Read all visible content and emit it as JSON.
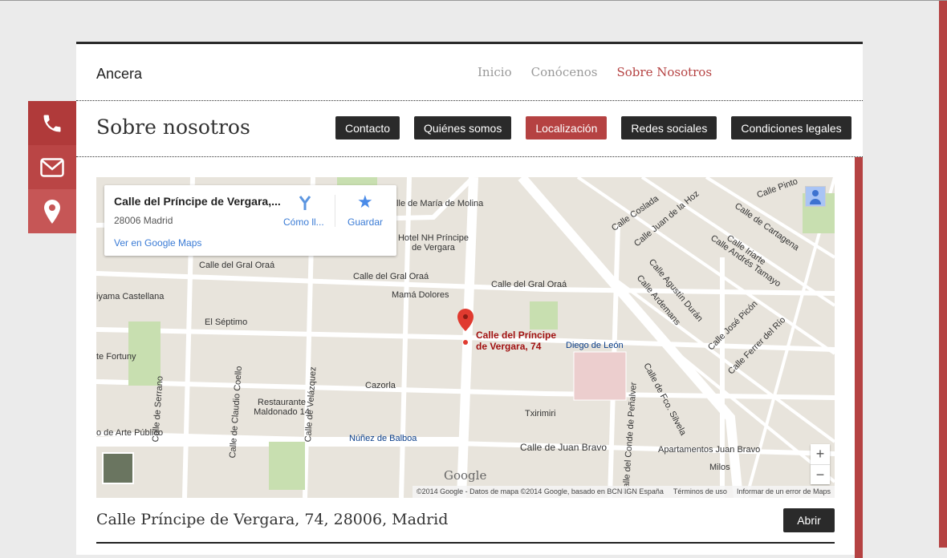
{
  "header": {
    "brand": "Ancera",
    "nav": [
      "Inicio",
      "Conócenos",
      "Sobre Nosotros"
    ]
  },
  "page": {
    "title": "Sobre nosotros",
    "tabs": [
      "Contacto",
      "Quiénes somos",
      "Localización",
      "Redes sociales",
      "Condiciones legales"
    ],
    "active_tab": "Localización"
  },
  "side_icons": [
    "phone-icon",
    "mail-icon",
    "location-icon"
  ],
  "map": {
    "card": {
      "title": "Calle del Príncipe de Vergara,...",
      "subtitle": "28006 Madrid",
      "link": "Ver en Google Maps",
      "directions": "Cómo ll...",
      "save": "Guardar"
    },
    "pin_label": "Calle del Príncipe de Vergara, 74",
    "labels": [
      "Calle de María de Molina",
      "Hotel NH Príncipe de Vergara",
      "Calle del Gral Oraá",
      "Calle del Gral Oraá",
      "Calle del Gral Oraá",
      "Mamá Dolores",
      "El Séptimo",
      "Diego de León",
      "Cazorla",
      "Restaurante Maldonado 14",
      "Núñez de Balboa",
      "Calle de Juan Bravo",
      "Txirimiri",
      "Apartamentos Juan Bravo",
      "Milos",
      "Calle de Serrano",
      "Calle de Claudio Coello",
      "Calle de Velázquez",
      "Calle del Conde de Peñalver",
      "Calle de Fco. Silvela",
      "Calle Coslada",
      "Calle Juan de la Hoz",
      "Calle de Cartagena",
      "Calle Iriarte",
      "Calle Andrés Tamayo",
      "Calle Agustín Durán",
      "Calle Ardemans",
      "Calle José Picón",
      "Calle Ferrer del Río",
      "iyama Castellana",
      "te Fortuny",
      "o de Arte Público",
      "Calle Pinto"
    ],
    "zoom_in": "+",
    "zoom_out": "−",
    "attribution": [
      "©2014 Google - Datos de mapa ©2014 Google, basado en BCN IGN España",
      "Términos de uso",
      "Informar de un error de Maps"
    ],
    "logo": "Google"
  },
  "address": "Calle Príncipe de Vergara, 74, 28006, Madrid",
  "open_button": "Abrir"
}
